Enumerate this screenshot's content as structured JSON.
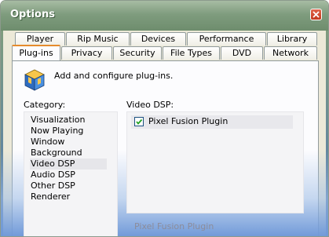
{
  "window": {
    "title": "Options"
  },
  "tabs_row1": [
    "Player",
    "Rip Music",
    "Devices",
    "Performance",
    "Library"
  ],
  "tabs_row2": [
    "Plug-ins",
    "Privacy",
    "Security",
    "File Types",
    "DVD",
    "Network"
  ],
  "selected_tab": "Plug-ins",
  "intro_text": "Add and configure plug-ins.",
  "category": {
    "label": "Category:",
    "items": [
      "Visualization",
      "Now Playing",
      "Window",
      "Background",
      "Video DSP",
      "Audio DSP",
      "Other DSP",
      "Renderer"
    ],
    "selected": "Video DSP"
  },
  "video_dsp": {
    "label": "Video DSP:",
    "plugins": [
      {
        "name": "Pixel Fusion Plugin",
        "checked": true
      }
    ]
  },
  "footer_plugin_name": "Pixel Fusion Plugin",
  "colors": {
    "titlebar": "#7f9c7e",
    "selected_tab_accent": "#e68b2c",
    "close_button": "#c33a1f"
  }
}
